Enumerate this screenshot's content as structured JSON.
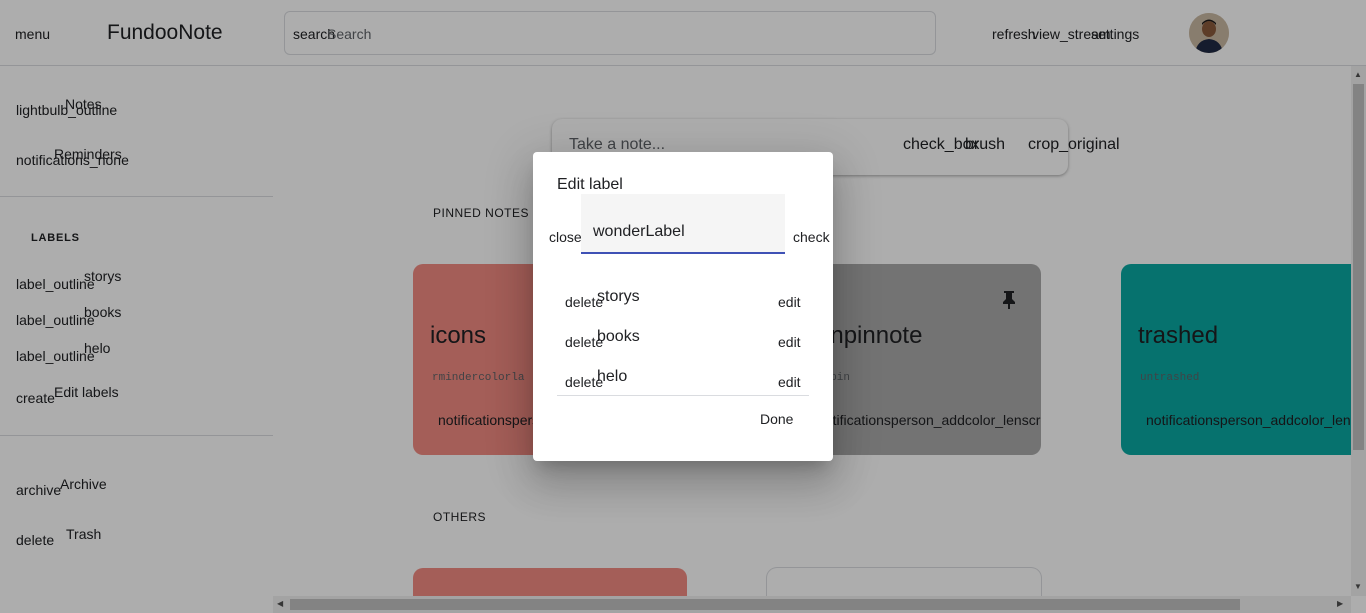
{
  "header": {
    "menu_icon": "menu",
    "app_title": "FundooNote",
    "search_icon": "search",
    "search_placeholder": "Search",
    "refresh_icon": "refresh",
    "view_stream_icon": "view_stream",
    "settings_icon": "settings"
  },
  "sidebar": {
    "items": [
      {
        "icon": "lightbulb_outline",
        "label": "Notes"
      },
      {
        "icon": "notifications_none",
        "label": "Reminders"
      }
    ],
    "labels_heading": "LABELS",
    "labels": [
      {
        "icon": "label_outline",
        "label": "storys"
      },
      {
        "icon": "label_outline",
        "label": "books"
      },
      {
        "icon": "label_outline",
        "label": "helo"
      }
    ],
    "edit_labels": {
      "icon": "create",
      "label": "Edit labels"
    },
    "bottom_items": [
      {
        "icon": "archive",
        "label": "Archive"
      },
      {
        "icon": "delete",
        "label": "Trash"
      }
    ]
  },
  "main": {
    "take_note_placeholder": "Take a note...",
    "take_note_icons": [
      "check_box",
      "brush",
      "crop_original"
    ],
    "pinned_title": "PINNED NOTES",
    "others_title": "OTHERS",
    "notes": [
      {
        "title": "icons",
        "body": "rmindercolorla",
        "tools": "notificationsperson_add",
        "color": "#f28b82"
      },
      {
        "title": "unpinnote",
        "body": "unpin",
        "tools": "notificationsperson_addcolor_lenscrop_originalarchivemore_vert",
        "color": "#aaaaaa"
      },
      {
        "title": "trashed",
        "body": "untrashed",
        "tools": "notificationsperson_addcolor_lenscrop_original",
        "color": "#0aa9a2"
      }
    ],
    "pin_icon": "push_pin"
  },
  "dialog": {
    "title": "Edit label",
    "close_icon": "close",
    "input_value": "wonderLabel",
    "check_icon": "check",
    "labels": [
      {
        "delete_icon": "delete",
        "name": "storys",
        "edit_icon": "edit"
      },
      {
        "delete_icon": "delete",
        "name": "books",
        "edit_icon": "edit"
      },
      {
        "delete_icon": "delete",
        "name": "helo",
        "edit_icon": "edit"
      }
    ],
    "done_label": "Done"
  },
  "colors": {
    "accent": "#3f51b5",
    "overlay": "rgba(0,0,0,0.32)"
  }
}
